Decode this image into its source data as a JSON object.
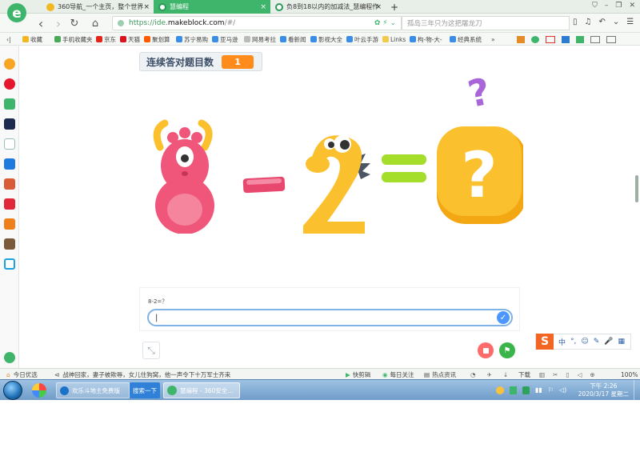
{
  "browser": {
    "tabs": [
      {
        "label": "360导航_一个主页，整个世界",
        "active": false
      },
      {
        "label": "慧编程",
        "active": true
      },
      {
        "label": "负8到18以内的加减法_慧编程作",
        "active": false
      }
    ],
    "new_tab": "+",
    "close_glyph": "×",
    "url_prefix": "https://ide.",
    "url_domain": "makeblock.com",
    "url_suffix": "/#/",
    "search_placeholder": "孤岛三年只为这把屠龙刀",
    "nav": {
      "back": "‹",
      "forward": "›",
      "reload": "↻",
      "home": "⌂"
    }
  },
  "bookmarks": [
    {
      "label": "收藏",
      "color": "#f2b824"
    },
    {
      "label": "手机收藏夹",
      "color": "#4aa85a"
    },
    {
      "label": "京东",
      "color": "#e1251b"
    },
    {
      "label": "天猫",
      "color": "#d8141d"
    },
    {
      "label": "聚划算",
      "color": "#ff5a00"
    },
    {
      "label": "苏宁易购",
      "color": "#3a8ee6"
    },
    {
      "label": "亚马逊",
      "color": "#3a8ee6"
    },
    {
      "label": "网易考拉",
      "color": "#bbbbbb"
    },
    {
      "label": "看新闻",
      "color": "#3a8ee6"
    },
    {
      "label": "影视大全",
      "color": "#3a8ee6"
    },
    {
      "label": "叶云手游",
      "color": "#3a8ee6"
    },
    {
      "label": "Links",
      "color": "#f2c94c"
    },
    {
      "label": "构-物-大-",
      "color": "#3a8ee6"
    },
    {
      "label": "经典系统",
      "color": "#3a8ee6"
    }
  ],
  "stage": {
    "monitor_label": "连续答对题目数",
    "monitor_value": "1",
    "ask_question": "8-2=？",
    "ask_input_value": "|",
    "check_glyph": "✓",
    "fullscreen_glyph": "⤡",
    "flag_glyph": "⚑",
    "equation_minus": "-",
    "question_mark": "?"
  },
  "ime": {
    "logo": "S",
    "items": [
      "中",
      "°,",
      "☺",
      "✎",
      "🎤",
      "▦"
    ]
  },
  "statusbar": {
    "left_label": "今日优选",
    "news": "战神回家，妻子被欺辱，女儿住狗窝，他一声令下十万军士齐来",
    "items": [
      "快剪辑",
      "每日关注",
      "热点资讯",
      "下载",
      "100%"
    ]
  },
  "taskbar": {
    "apps": [
      {
        "label": "欢乐斗地主免费版"
      },
      {
        "label": "搜索一下"
      },
      {
        "label": "慧编程 - 360安全..."
      }
    ],
    "time": "下午 2:26",
    "date": "2020/3/17 星期二"
  },
  "colors": {
    "accent_green": "#3fb56b",
    "monitor_orange": "#ff8c1a",
    "stop_red": "#ff6b6b",
    "go_green": "#3ab54a",
    "pink_eight": "#f0567a",
    "yellow": "#fbc02d"
  }
}
